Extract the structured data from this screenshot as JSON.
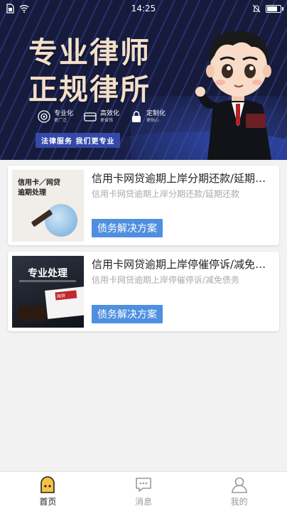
{
  "status_bar": {
    "time": "14:25",
    "battery_level": 0.85
  },
  "banner": {
    "title_line1": "专业律师",
    "title_line2": "正规律所",
    "features": [
      {
        "main": "专业化",
        "sub": "更广泛",
        "icon": "target-icon"
      },
      {
        "main": "高效化",
        "sub": "更省钱",
        "icon": "card-icon"
      },
      {
        "main": "定制化",
        "sub": "更贴心",
        "icon": "lock-icon"
      }
    ],
    "slogan": "法律服务 我们更专业",
    "colors": {
      "background": "#1a1f45",
      "title": "#f3dfc9",
      "slogan_bg": "#3449a8"
    }
  },
  "cards": [
    {
      "title": "信用卡网贷逾期上岸分期还款/延期还款",
      "subtitle": "信用卡网贷逾期上岸分期还款/延期还款",
      "tag": "债务解决方案",
      "thumb_text": "信用卡／网贷\n逾期处理"
    },
    {
      "title": "信用卡网贷逾期上岸停催停诉/减免债务",
      "subtitle": "信用卡网贷逾期上岸停催停诉/减免债务",
      "tag": "债务解决方案",
      "thumb_text": "专业处理",
      "thumb_badge": "网贷"
    }
  ],
  "bottom_nav": [
    {
      "label": "首页",
      "icon": "home-icon",
      "active": true
    },
    {
      "label": "消息",
      "icon": "message-icon",
      "active": false
    },
    {
      "label": "我的",
      "icon": "profile-icon",
      "active": false
    }
  ],
  "accent_color": "#4f8fe0",
  "nav_active_color": "#f6c244"
}
